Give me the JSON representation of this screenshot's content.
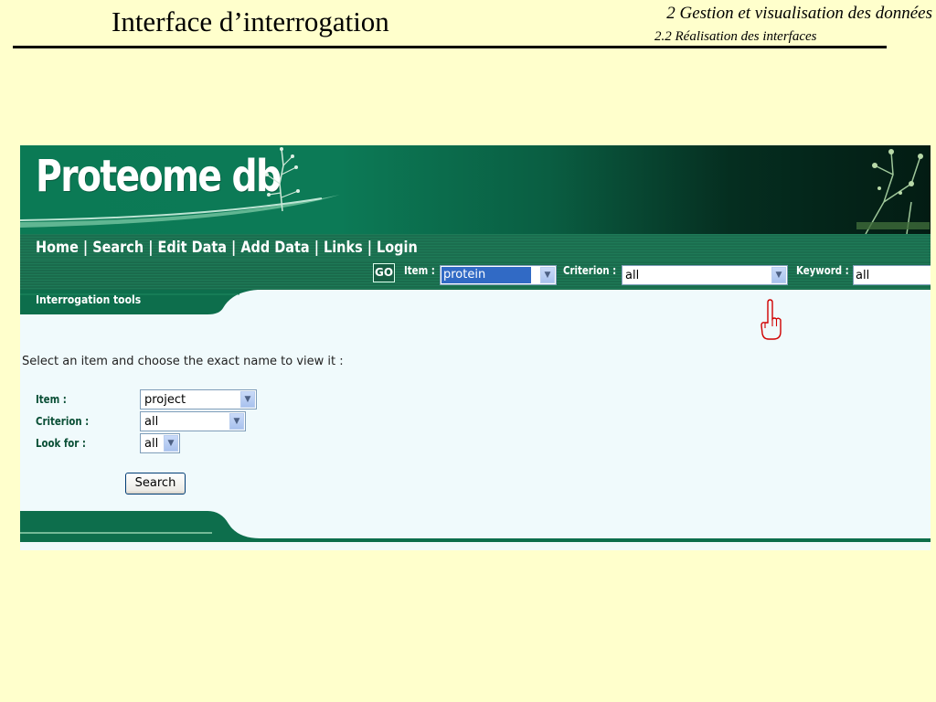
{
  "slide": {
    "title": "Interface d’interrogation",
    "section": "2 Gestion et visualisation des données",
    "subsection": "2.2 Réalisation des interfaces"
  },
  "app": {
    "logo": "Proteome db",
    "nav": {
      "items": [
        "Home",
        "Search",
        "Edit Data",
        "Add Data",
        "Links",
        "Login"
      ],
      "separator": " | "
    },
    "searchbar": {
      "go_label": "GO",
      "item_label": "Item :",
      "item_value": "protein",
      "criterion_label": "Criterion :",
      "criterion_value": "all",
      "keyword_label": "Keyword :",
      "keyword_value": "all"
    },
    "section_label": "Interrogation tools",
    "instruction": "Select an item and choose the exact name to view it :",
    "form": {
      "item_label": "Item :",
      "item_value": "project",
      "criterion_label": "Criterion :",
      "criterion_value": "all",
      "lookfor_label": "Look for :",
      "lookfor_value": "all",
      "search_button": "Search"
    },
    "colors": {
      "slide_background": "#FFFFCC",
      "banner_green": "#0B7A55",
      "dark_green": "#0A4F36",
      "page_background": "#F0FAFC",
      "pointer_red": "#D00000"
    },
    "icons": [
      "pointing-hand-icon",
      "plant-icon",
      "dropdown-arrow-icon"
    ]
  }
}
